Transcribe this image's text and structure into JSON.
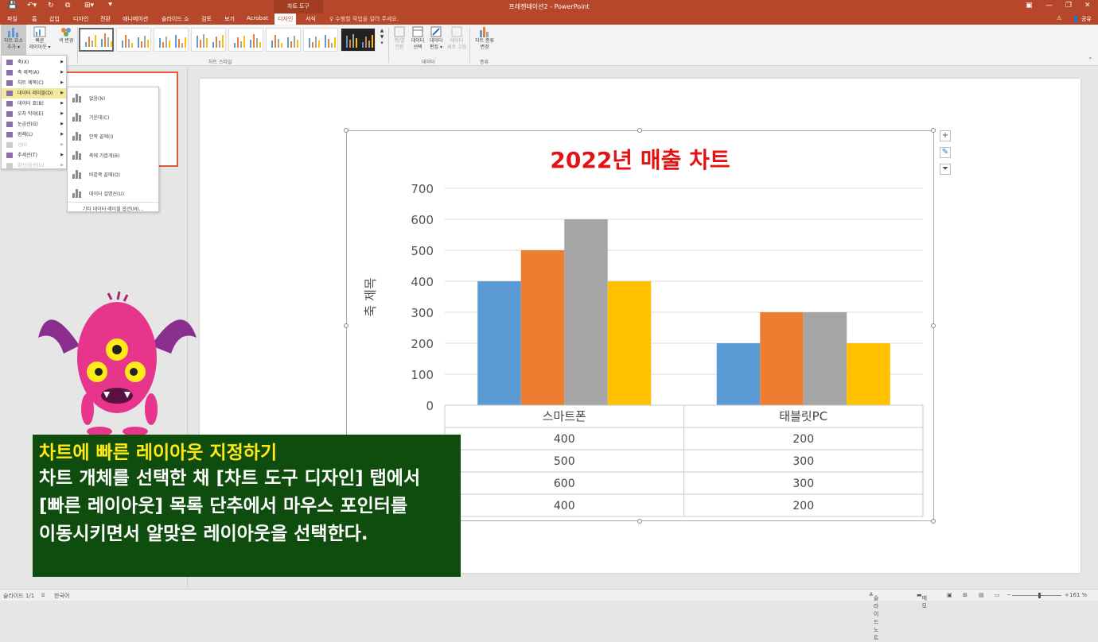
{
  "titlebar": {
    "context_tab": "차트 도구",
    "doc_title": "프레젠테이션2 - PowerPoint"
  },
  "tabs": [
    "파일",
    "홈",
    "삽입",
    "디자인",
    "전환",
    "애니메이션",
    "슬라이드 쇼",
    "검토",
    "보기",
    "Acrobat",
    "디자인",
    "서식"
  ],
  "tell_me": "♀ 수행할 작업을 알려 주세요.",
  "share": "공유",
  "ribbon": {
    "add_element": "차트 요소\n추가 ▾",
    "quick_layout": "빠른\n레이아웃 ▾",
    "change_color": "색 변경",
    "chart_styles_label": "차트 스타일",
    "switch_row_col": "행/열\n전환",
    "select_data": "데이터\n선택",
    "edit_data": "데이터\n편집 ▾",
    "refresh_data": "데이터\n새로 고침",
    "data_label": "데이터",
    "change_type": "차트 종류\n변경",
    "type_label": "종류"
  },
  "element_menu": [
    {
      "label": "축(X)",
      "state": "normal"
    },
    {
      "label": "축 제목(A)",
      "state": "normal"
    },
    {
      "label": "차트 제목(C)",
      "state": "normal"
    },
    {
      "label": "데이터 레이블(D)",
      "state": "highlight"
    },
    {
      "label": "데이터 표(B)",
      "state": "normal"
    },
    {
      "label": "오차 막대(E)",
      "state": "normal"
    },
    {
      "label": "눈금선(G)",
      "state": "normal"
    },
    {
      "label": "범례(L)",
      "state": "normal"
    },
    {
      "label": "선(I)",
      "state": "disabled"
    },
    {
      "label": "추세선(T)",
      "state": "normal"
    },
    {
      "label": "양선/음선(U)",
      "state": "disabled"
    }
  ],
  "label_submenu": [
    "없음(N)",
    "가운데(C)",
    "안쪽 끝에(I)",
    "축에 가깝게(B)",
    "바깥쪽 끝에(O)",
    "데이터 설명선(U)"
  ],
  "label_submenu_more": "기타 데이터 레이블 옵션(M)...",
  "chart_data": {
    "type": "bar",
    "title": "2022년 매출 차트",
    "ylabel": "축 제목",
    "xlabel": "",
    "categories": [
      "스마트폰",
      "태블릿PC"
    ],
    "series": [
      {
        "values": [
          400,
          200
        ],
        "color": "#5b9bd5"
      },
      {
        "values": [
          500,
          300
        ],
        "color": "#ed7d31"
      },
      {
        "values": [
          600,
          300
        ],
        "color": "#a5a5a5"
      },
      {
        "values": [
          400,
          200
        ],
        "color": "#ffc000"
      }
    ],
    "ylim": [
      0,
      700
    ],
    "yticks": [
      0,
      100,
      200,
      300,
      400,
      500,
      600,
      700
    ],
    "grid": true,
    "data_table": true
  },
  "caption": {
    "heading": "차트에 빠른 레이아웃 지정하기",
    "lines": [
      "차트 개체를 선택한 채 [차트 도구 디자인] 탭에서",
      "[빠른 레이아웃] 목록 단추에서 마우스 포인터를",
      "이동시키면서 알맞은 레이아웃을 선택한다."
    ]
  },
  "statusbar": {
    "slide": "슬라이드 1/1",
    "language": "한국어",
    "notes": "슬라이드 노트",
    "comments": "메모",
    "zoom": "161 %"
  }
}
